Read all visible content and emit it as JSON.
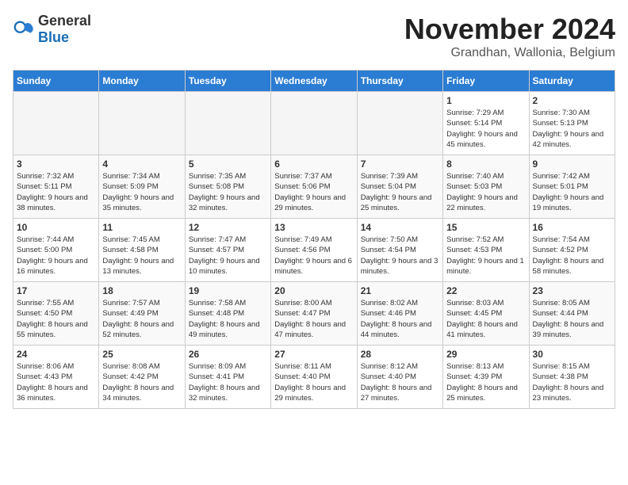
{
  "logo": {
    "text_general": "General",
    "text_blue": "Blue"
  },
  "title": {
    "month": "November 2024",
    "location": "Grandhan, Wallonia, Belgium"
  },
  "days_of_week": [
    "Sunday",
    "Monday",
    "Tuesday",
    "Wednesday",
    "Thursday",
    "Friday",
    "Saturday"
  ],
  "weeks": [
    [
      {
        "day": "",
        "info": ""
      },
      {
        "day": "",
        "info": ""
      },
      {
        "day": "",
        "info": ""
      },
      {
        "day": "",
        "info": ""
      },
      {
        "day": "",
        "info": ""
      },
      {
        "day": "1",
        "info": "Sunrise: 7:29 AM\nSunset: 5:14 PM\nDaylight: 9 hours and 45 minutes."
      },
      {
        "day": "2",
        "info": "Sunrise: 7:30 AM\nSunset: 5:13 PM\nDaylight: 9 hours and 42 minutes."
      }
    ],
    [
      {
        "day": "3",
        "info": "Sunrise: 7:32 AM\nSunset: 5:11 PM\nDaylight: 9 hours and 38 minutes."
      },
      {
        "day": "4",
        "info": "Sunrise: 7:34 AM\nSunset: 5:09 PM\nDaylight: 9 hours and 35 minutes."
      },
      {
        "day": "5",
        "info": "Sunrise: 7:35 AM\nSunset: 5:08 PM\nDaylight: 9 hours and 32 minutes."
      },
      {
        "day": "6",
        "info": "Sunrise: 7:37 AM\nSunset: 5:06 PM\nDaylight: 9 hours and 29 minutes."
      },
      {
        "day": "7",
        "info": "Sunrise: 7:39 AM\nSunset: 5:04 PM\nDaylight: 9 hours and 25 minutes."
      },
      {
        "day": "8",
        "info": "Sunrise: 7:40 AM\nSunset: 5:03 PM\nDaylight: 9 hours and 22 minutes."
      },
      {
        "day": "9",
        "info": "Sunrise: 7:42 AM\nSunset: 5:01 PM\nDaylight: 9 hours and 19 minutes."
      }
    ],
    [
      {
        "day": "10",
        "info": "Sunrise: 7:44 AM\nSunset: 5:00 PM\nDaylight: 9 hours and 16 minutes."
      },
      {
        "day": "11",
        "info": "Sunrise: 7:45 AM\nSunset: 4:58 PM\nDaylight: 9 hours and 13 minutes."
      },
      {
        "day": "12",
        "info": "Sunrise: 7:47 AM\nSunset: 4:57 PM\nDaylight: 9 hours and 10 minutes."
      },
      {
        "day": "13",
        "info": "Sunrise: 7:49 AM\nSunset: 4:56 PM\nDaylight: 9 hours and 6 minutes."
      },
      {
        "day": "14",
        "info": "Sunrise: 7:50 AM\nSunset: 4:54 PM\nDaylight: 9 hours and 3 minutes."
      },
      {
        "day": "15",
        "info": "Sunrise: 7:52 AM\nSunset: 4:53 PM\nDaylight: 9 hours and 1 minute."
      },
      {
        "day": "16",
        "info": "Sunrise: 7:54 AM\nSunset: 4:52 PM\nDaylight: 8 hours and 58 minutes."
      }
    ],
    [
      {
        "day": "17",
        "info": "Sunrise: 7:55 AM\nSunset: 4:50 PM\nDaylight: 8 hours and 55 minutes."
      },
      {
        "day": "18",
        "info": "Sunrise: 7:57 AM\nSunset: 4:49 PM\nDaylight: 8 hours and 52 minutes."
      },
      {
        "day": "19",
        "info": "Sunrise: 7:58 AM\nSunset: 4:48 PM\nDaylight: 8 hours and 49 minutes."
      },
      {
        "day": "20",
        "info": "Sunrise: 8:00 AM\nSunset: 4:47 PM\nDaylight: 8 hours and 47 minutes."
      },
      {
        "day": "21",
        "info": "Sunrise: 8:02 AM\nSunset: 4:46 PM\nDaylight: 8 hours and 44 minutes."
      },
      {
        "day": "22",
        "info": "Sunrise: 8:03 AM\nSunset: 4:45 PM\nDaylight: 8 hours and 41 minutes."
      },
      {
        "day": "23",
        "info": "Sunrise: 8:05 AM\nSunset: 4:44 PM\nDaylight: 8 hours and 39 minutes."
      }
    ],
    [
      {
        "day": "24",
        "info": "Sunrise: 8:06 AM\nSunset: 4:43 PM\nDaylight: 8 hours and 36 minutes."
      },
      {
        "day": "25",
        "info": "Sunrise: 8:08 AM\nSunset: 4:42 PM\nDaylight: 8 hours and 34 minutes."
      },
      {
        "day": "26",
        "info": "Sunrise: 8:09 AM\nSunset: 4:41 PM\nDaylight: 8 hours and 32 minutes."
      },
      {
        "day": "27",
        "info": "Sunrise: 8:11 AM\nSunset: 4:40 PM\nDaylight: 8 hours and 29 minutes."
      },
      {
        "day": "28",
        "info": "Sunrise: 8:12 AM\nSunset: 4:40 PM\nDaylight: 8 hours and 27 minutes."
      },
      {
        "day": "29",
        "info": "Sunrise: 8:13 AM\nSunset: 4:39 PM\nDaylight: 8 hours and 25 minutes."
      },
      {
        "day": "30",
        "info": "Sunrise: 8:15 AM\nSunset: 4:38 PM\nDaylight: 8 hours and 23 minutes."
      }
    ]
  ]
}
